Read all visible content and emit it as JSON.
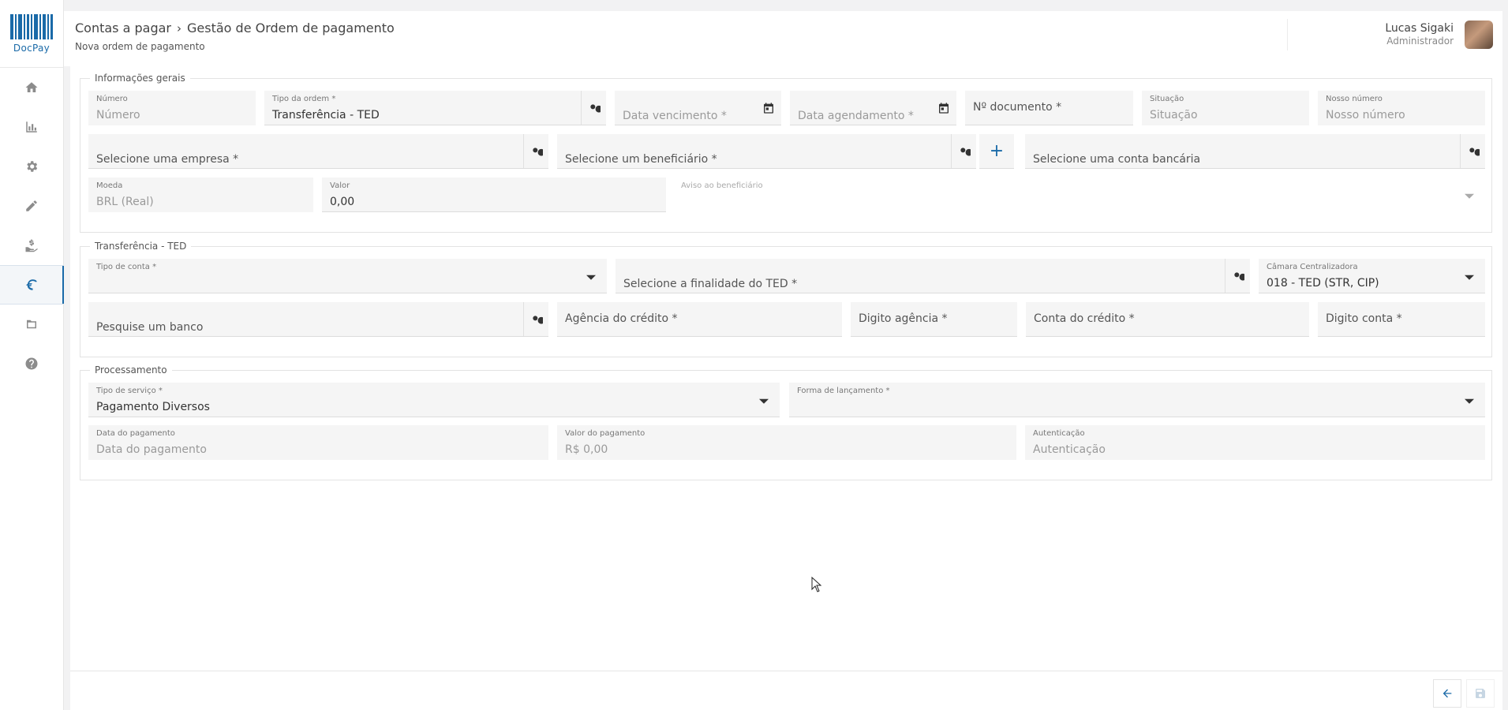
{
  "brand": {
    "name": "DocPay"
  },
  "sidebar": {
    "items": [
      {
        "name": "home",
        "icon": "home-icon"
      },
      {
        "name": "reports",
        "icon": "bar-chart-icon"
      },
      {
        "name": "settings",
        "icon": "gear-icon"
      },
      {
        "name": "edit",
        "icon": "pencil-icon"
      },
      {
        "name": "receive",
        "icon": "hand-money-icon"
      },
      {
        "name": "payments",
        "icon": "payment-icon",
        "active": true
      },
      {
        "name": "folders",
        "icon": "folder-icon"
      },
      {
        "name": "help",
        "icon": "help-icon"
      }
    ]
  },
  "header": {
    "breadcrumb": [
      "Contas a pagar",
      "Gestão de Ordem de pagamento"
    ],
    "subtitle": "Nova ordem de pagamento",
    "user": {
      "name": "Lucas Sigaki",
      "role": "Administrador"
    }
  },
  "info_gerais": {
    "legend": "Informações gerais",
    "numero": {
      "label": "Número",
      "placeholder": "Número"
    },
    "tipo_ordem": {
      "label": "Tipo da ordem *",
      "value": "Transferência - TED"
    },
    "data_vencimento": {
      "placeholder": "Data vencimento *"
    },
    "data_agendamento": {
      "placeholder": "Data agendamento *"
    },
    "n_documento": {
      "placeholder": "Nº documento *"
    },
    "situacao": {
      "label": "Situação",
      "placeholder": "Situação"
    },
    "nosso_numero": {
      "label": "Nosso número",
      "placeholder": "Nosso número"
    },
    "empresa": {
      "placeholder": "Selecione uma empresa *"
    },
    "beneficiario": {
      "placeholder": "Selecione um beneficiário *"
    },
    "add_symbol": "+",
    "conta_bancaria": {
      "placeholder": "Selecione uma conta bancária"
    },
    "moeda": {
      "label": "Moeda",
      "value": "BRL (Real)"
    },
    "valor": {
      "label": "Valor",
      "value": "0,00"
    },
    "aviso": {
      "label": "Aviso ao beneficiário"
    }
  },
  "ted": {
    "legend": "Transferência - TED",
    "tipo_conta": {
      "label": "Tipo de conta *"
    },
    "finalidade": {
      "placeholder": "Selecione a finalidade do TED *"
    },
    "camara": {
      "label": "Câmara Centralizadora",
      "value": "018 - TED (STR, CIP)"
    },
    "banco": {
      "placeholder": "Pesquise um banco"
    },
    "agencia": {
      "placeholder": "Agência do crédito *"
    },
    "digito_agencia": {
      "placeholder": "Digito agência *"
    },
    "conta_credito": {
      "placeholder": "Conta do crédito *"
    },
    "digito_conta": {
      "placeholder": "Digito conta *"
    }
  },
  "processamento": {
    "legend": "Processamento",
    "tipo_servico": {
      "label": "Tipo de serviço *",
      "value": "Pagamento Diversos"
    },
    "forma_lancamento": {
      "label": "Forma de lançamento *"
    },
    "data_pagamento": {
      "label": "Data do pagamento",
      "placeholder": "Data do pagamento"
    },
    "valor_pagamento": {
      "label": "Valor do pagamento",
      "placeholder": "R$ 0,00"
    },
    "autenticacao": {
      "label": "Autenticação",
      "placeholder": "Autenticação"
    }
  },
  "colors": {
    "accent": "#1a6aa8",
    "field_bg": "#f5f5f5",
    "page_bg": "#f2f2f3"
  }
}
